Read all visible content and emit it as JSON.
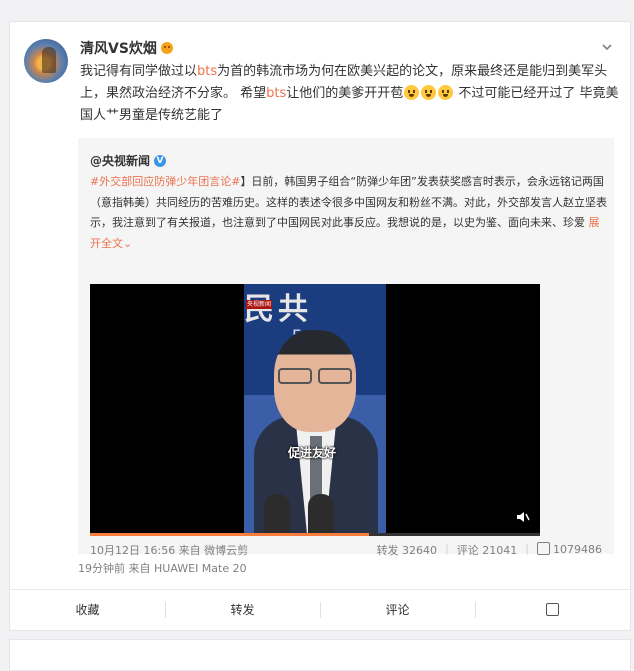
{
  "post": {
    "username": "清风VS炊烟",
    "text_parts": {
      "p1": "我记得有同学做过以",
      "bts1": "bts",
      "p2": "为首的韩流市场为何在欧美兴起的论文，原来最终还是能归到美军头上，果然政治经济不分家。 希望",
      "bts2": "bts",
      "p3": "让他们的美爹开开苞",
      "p4": " 不过可能已经开过了 毕竟美国人艹男童是传统艺能了"
    },
    "meta": "19分钟前  来自 HUAWEI Mate 20"
  },
  "repost": {
    "author": "@央视新闻",
    "topic": "#外交部回应防弹少年团言论#",
    "text": "】日前，韩国男子组合“防弹少年团”发表获奖感言时表示，会永远铭记两国（意指韩美）共同经历的苦难历史。这样的表述令很多中国网友和粉丝不满。对此，外交部发言人赵立坚表示，我注意到了有关报道，也注意到了中国网民对此事反应。我想说的是，以史为鉴、面向未来、珍爱 ",
    "expand": "展开全文",
    "expand_arrow": "⌄",
    "video": {
      "bg_chars": "民共",
      "bg_sub": "F o",
      "logo": "央视新闻",
      "caption": "促进友好",
      "progress": 0.62
    },
    "date": "10月12日 16:56 来自 微博云剪",
    "actions": {
      "repost": "转发 32640",
      "comment": "评论 21041",
      "like": "1079486"
    }
  },
  "action_bar": {
    "favorite": "收藏",
    "repost": "转发",
    "comment": "评论"
  },
  "colors": {
    "accent": "#eb7350",
    "link_blue": "#3b95e6",
    "progress": "#fa7d3c"
  }
}
